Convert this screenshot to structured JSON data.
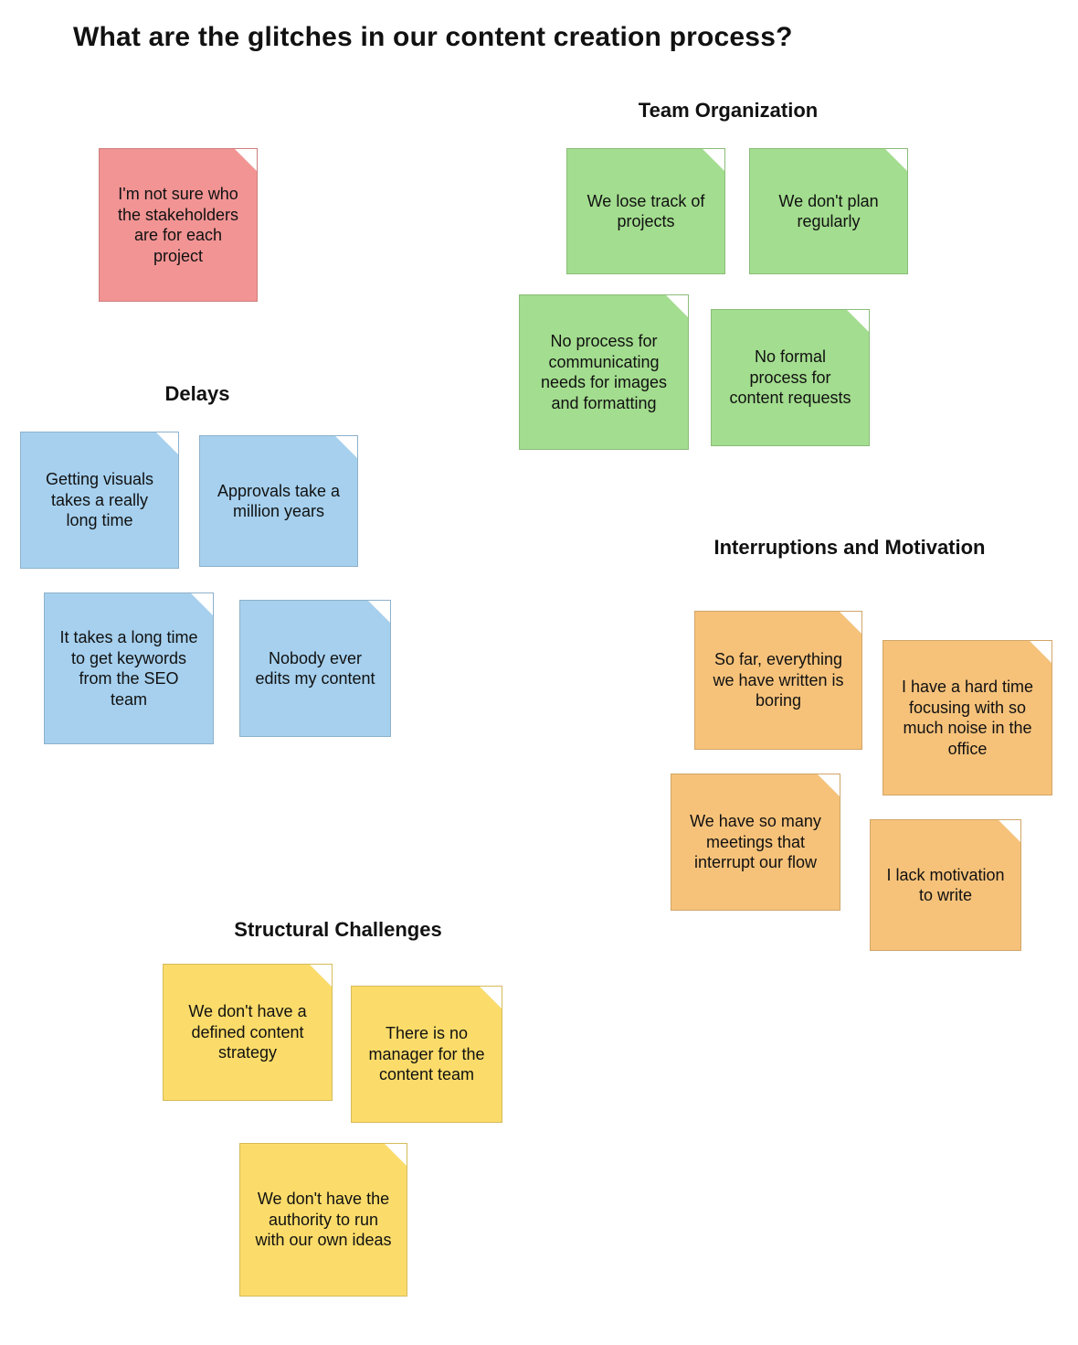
{
  "title": "What are the glitches in our content creation process?",
  "groups": {
    "team_org": "Team Organization",
    "delays": "Delays",
    "interruptions": "Interruptions and Motivation",
    "structural": "Structural Challenges"
  },
  "notes": {
    "stakeholders": "I'm not sure who the stakeholders are for each project",
    "lose_track": "We lose track of projects",
    "no_plan": "We don't plan regularly",
    "no_comms_process": "No process for communicating needs for images and formatting",
    "no_request_process": "No formal process for content requests",
    "visuals_slow": "Getting visuals takes a really long time",
    "approvals_slow": "Approvals take a million years",
    "seo_keywords_slow": "It takes a long time to get keywords from the SEO team",
    "no_edits": "Nobody ever edits my content",
    "boring": "So far, everything we have written is boring",
    "noise": "I have a hard time focusing with so much noise in the office",
    "meetings": "We have so many meetings that interrupt our flow",
    "motivation": "I lack motivation to write",
    "no_strategy": "We don't have a defined content strategy",
    "no_manager": "There is no manager for the content team",
    "no_authority": "We don't have the authority to run with our own ideas"
  },
  "colors": {
    "red": "#f29494",
    "green": "#a3dd8f",
    "blue": "#a6d0ee",
    "orange": "#f6c27a",
    "yellow": "#fbdc6a"
  }
}
